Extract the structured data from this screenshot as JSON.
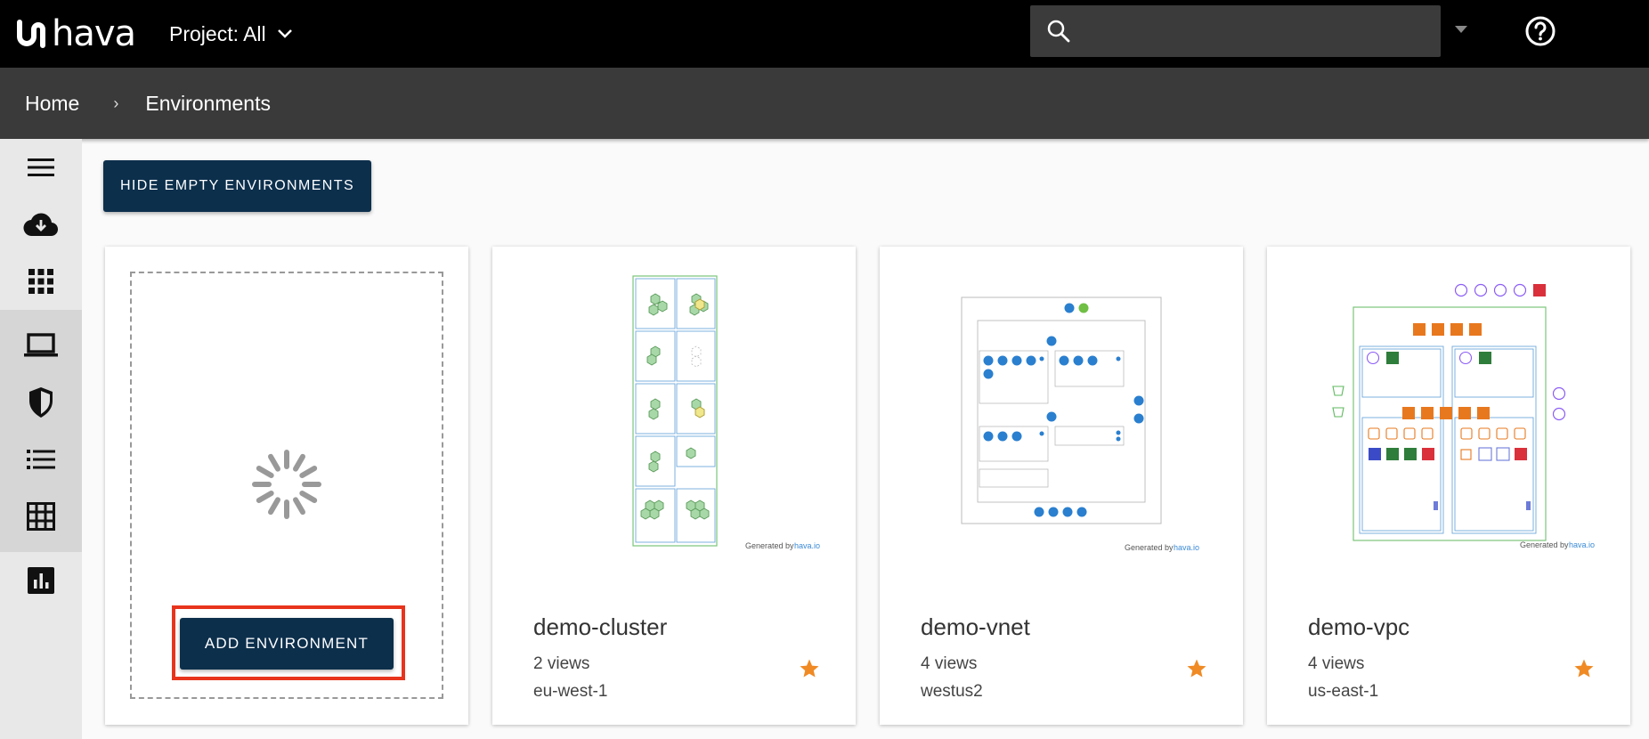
{
  "app": {
    "logo_text": "hava"
  },
  "header": {
    "project_label": "Project: All",
    "search": {
      "value": "",
      "placeholder": ""
    }
  },
  "breadcrumb": {
    "home": "Home",
    "separator": "›",
    "current": "Environments"
  },
  "sidebar": {
    "items": [
      {
        "name": "menu",
        "icon": "hamburger-icon"
      },
      {
        "name": "import",
        "icon": "cloud-download-icon"
      },
      {
        "name": "apps",
        "icon": "apps-grid-icon"
      },
      {
        "name": "environments",
        "icon": "laptop-icon"
      },
      {
        "name": "security",
        "icon": "shield-icon"
      },
      {
        "name": "list",
        "icon": "list-icon"
      },
      {
        "name": "table",
        "icon": "table-grid-icon"
      },
      {
        "name": "reports",
        "icon": "bar-chart-icon"
      }
    ]
  },
  "toolbar": {
    "hide_empty_label": "HIDE EMPTY ENVIRONMENTS"
  },
  "add_card": {
    "add_label": "ADD ENVIRONMENT"
  },
  "environments": [
    {
      "name": "demo-cluster",
      "views": "2 views",
      "region": "eu-west-1",
      "generated_by": "Generated by",
      "generated_brand": "hava.io"
    },
    {
      "name": "demo-vnet",
      "views": "4 views",
      "region": "westus2",
      "generated_by": "Generated by",
      "generated_brand": "hava.io"
    },
    {
      "name": "demo-vpc",
      "views": "4 views",
      "region": "us-east-1",
      "generated_by": "Generated by",
      "generated_brand": "hava.io"
    }
  ],
  "colors": {
    "navy": "#0c2f4c",
    "star": "#f08a24",
    "highlight": "#e8341c"
  }
}
